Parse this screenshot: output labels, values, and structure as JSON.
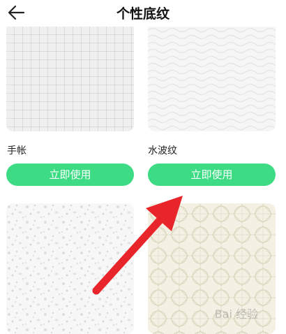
{
  "header": {
    "title": "个性底纹",
    "back_icon": "back-arrow-icon"
  },
  "items": [
    {
      "name": "手帐",
      "button": "立即使用",
      "texture": "grid"
    },
    {
      "name": "水波纹",
      "button": "立即使用",
      "texture": "waves"
    },
    {
      "name": "",
      "button": "",
      "texture": "terrazzo"
    },
    {
      "name": "",
      "button": "",
      "texture": "lattice"
    }
  ],
  "watermark": "Bai 经验",
  "colors": {
    "accent": "#3ddc84",
    "arrow": "#e8252b",
    "grid_bg": "#efefef",
    "lattice_bg": "#f4f1e4"
  }
}
